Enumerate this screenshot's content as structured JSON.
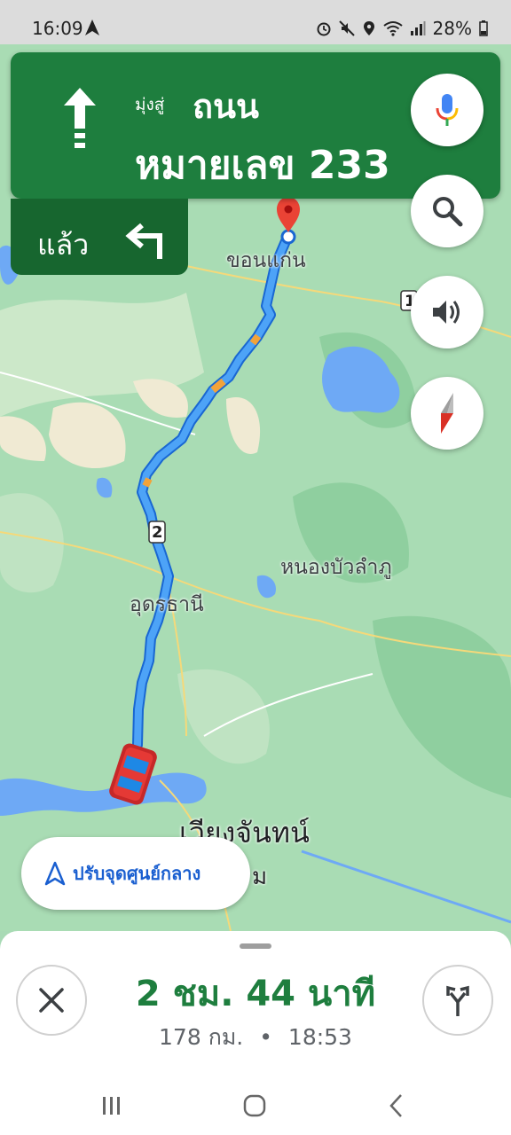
{
  "status_bar": {
    "time": "16:09",
    "icons": [
      "navigation-icon",
      "alarm-icon",
      "mute-icon",
      "location-icon",
      "wifi-icon",
      "signal-icon"
    ],
    "battery": "28%"
  },
  "banner": {
    "toward": "มุ่งสู่",
    "road_line1": "ถนน",
    "road_line2": "หมายเลข 233",
    "direction": "straight-arrow-icon",
    "then_label": "แล้ว",
    "then_direction": "turn-left-icon",
    "color": "#1e7e3e"
  },
  "map": {
    "labels": {
      "khon_kaen": "ขอนแก่น",
      "udon_thani": "อุดรธานี",
      "nong_bua": "หนองบัวลำภู",
      "vientiane": "เวียงจันทน์",
      "vientiane_suffix": "ม",
      "route_shield": "2",
      "shield_right": "1"
    },
    "route_color": "#4285f4"
  },
  "controls": {
    "mic": "mic-icon",
    "search": "search-icon",
    "sound": "volume-icon",
    "compass": "compass-icon"
  },
  "recenter": {
    "label": "ปรับจุดศูนย์กลาง"
  },
  "sheet": {
    "eta_duration": "2 ชม. 44 นาที",
    "distance": "178 กม.",
    "separator": "•",
    "arrival_time": "18:53"
  }
}
